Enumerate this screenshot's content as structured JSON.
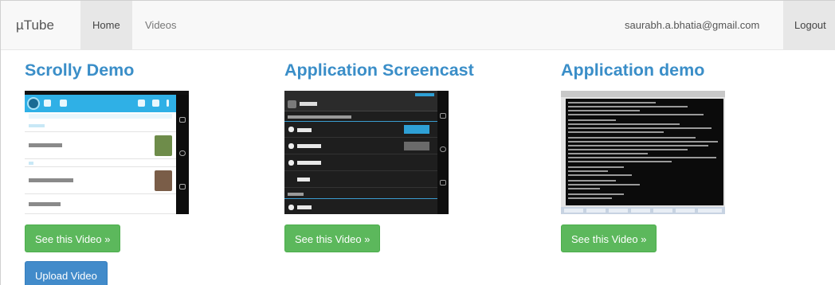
{
  "navbar": {
    "brand": "µTube",
    "home": "Home",
    "videos": "Videos",
    "email": "saurabh.a.bhatia@gmail.com",
    "logout": "Logout"
  },
  "videos": [
    {
      "title": "Scrolly Demo",
      "button": "See this Video »"
    },
    {
      "title": "Application Screencast",
      "button": "See this Video »"
    },
    {
      "title": "Application demo",
      "button": "See this Video »"
    }
  ],
  "upload": {
    "label": "Upload Video"
  },
  "colors": {
    "title": "#3a8ec8",
    "success": "#5cb85c",
    "primary": "#428bca",
    "navbar": "#f8f8f8"
  }
}
